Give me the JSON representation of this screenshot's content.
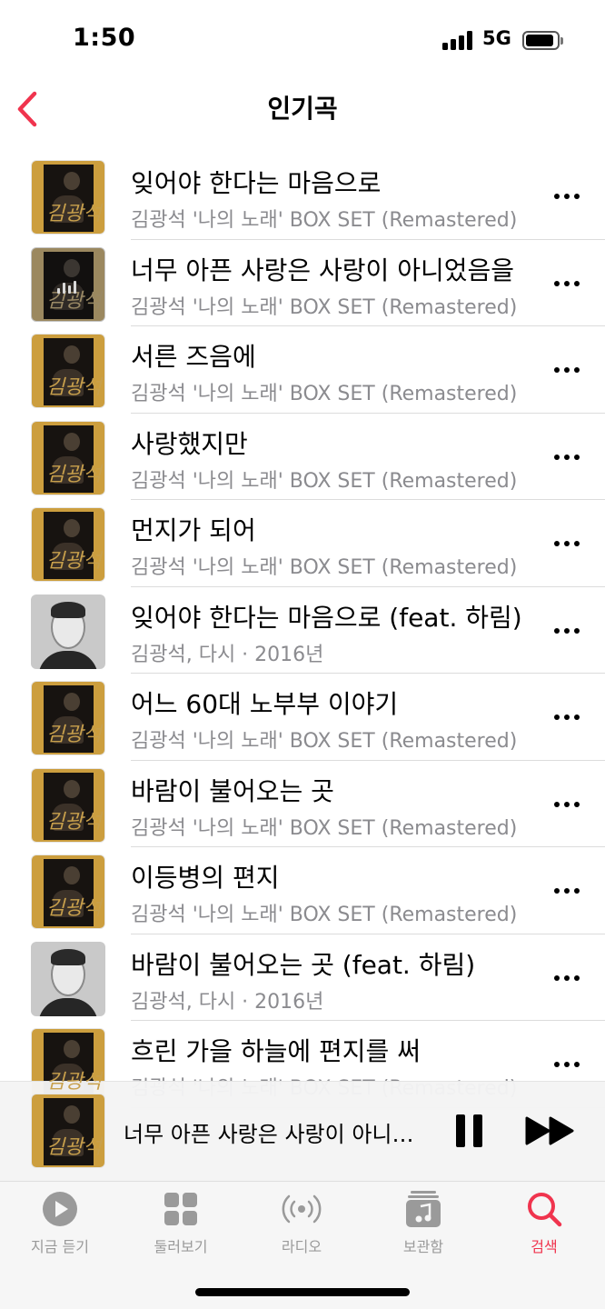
{
  "status_bar": {
    "time": "1:50",
    "network": "5G"
  },
  "nav": {
    "title": "인기곡"
  },
  "songs": [
    {
      "title": "잊어야 한다는 마음으로",
      "subtitle": "김광석 '나의 노래' BOX SET (Remastered)",
      "art": "gold"
    },
    {
      "title": "너무 아픈 사랑은 사랑이 아니었음을",
      "subtitle": "김광석 '나의 노래' BOX SET (Remastered)",
      "art": "gold-playing"
    },
    {
      "title": "서른 즈음에",
      "subtitle": "김광석 '나의 노래' BOX SET (Remastered)",
      "art": "gold"
    },
    {
      "title": "사랑했지만",
      "subtitle": "김광석 '나의 노래' BOX SET (Remastered)",
      "art": "gold"
    },
    {
      "title": "먼지가 되어",
      "subtitle": "김광석 '나의 노래' BOX SET (Remastered)",
      "art": "gold"
    },
    {
      "title": "잊어야 한다는 마음으로 (feat. 하림)",
      "subtitle": "김광석, 다시 · 2016년",
      "art": "gray"
    },
    {
      "title": "어느 60대 노부부 이야기",
      "subtitle": "김광석 '나의 노래' BOX SET (Remastered)",
      "art": "gold"
    },
    {
      "title": "바람이 불어오는 곳",
      "subtitle": "김광석 '나의 노래' BOX SET (Remastered)",
      "art": "gold"
    },
    {
      "title": "이등병의 편지",
      "subtitle": "김광석 '나의 노래' BOX SET (Remastered)",
      "art": "gold"
    },
    {
      "title": "바람이 불어오는 곳 (feat. 하림)",
      "subtitle": "김광석, 다시 · 2016년",
      "art": "gray"
    },
    {
      "title": "흐린 가을 하늘에 편지를 써",
      "subtitle": "김광석 '나의 노래' BOX SET (Remastered)",
      "art": "gold"
    }
  ],
  "art_glyph": "김광석",
  "now_playing": {
    "title": "너무 아픈 사랑은 사랑이 아니었음을"
  },
  "tabs": [
    {
      "label": "지금 듣기",
      "icon": "play-circle-icon",
      "active": false
    },
    {
      "label": "둘러보기",
      "icon": "grid-icon",
      "active": false
    },
    {
      "label": "라디오",
      "icon": "radio-waves-icon",
      "active": false
    },
    {
      "label": "보관함",
      "icon": "music-library-icon",
      "active": false
    },
    {
      "label": "검색",
      "icon": "search-icon",
      "active": true
    }
  ],
  "colors": {
    "accent": "#f0344e",
    "tab_inactive": "#9a9a9a",
    "secondary_text": "#8b8b8f"
  }
}
